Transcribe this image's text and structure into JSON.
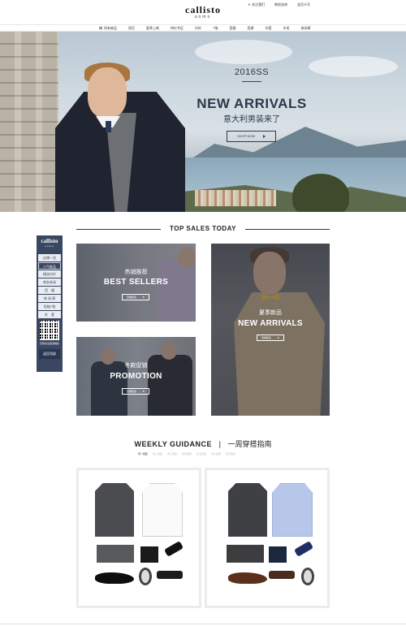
{
  "brand": {
    "name": "callisto",
    "sub": "uomo"
  },
  "toplinks": {
    "favorite": "关注我们",
    "service": "售前咨询",
    "vip": "会员卡号"
  },
  "nav": {
    "items": [
      "所有商品",
      "首页",
      "夏季上新",
      "特价专区",
      "衬衫",
      "T恤",
      "西服",
      "西裤",
      "外套",
      "羊毛",
      "休闲裤"
    ]
  },
  "hero": {
    "season": "2016SS",
    "title": "NEW ARRIVALS",
    "subtitle": "意大利男装来了",
    "button": "SHOP NOW"
  },
  "top_sales": {
    "title": "TOP SALES TODAY"
  },
  "sidebar": {
    "logo_main": "callisto",
    "logo_sub": "uomo",
    "items": [
      "店铺一览",
      "人气新品",
      "精选衬衫",
      "商务休闲",
      "西　服",
      "休 闲 裤",
      "短袖T恤",
      "外　套"
    ],
    "qr_text": "扫码关注更多精彩",
    "top_button": "返回顶部"
  },
  "tiles": {
    "best_sellers": {
      "cn": "热销推荐",
      "en": "BEST SELLERS",
      "btn": "查看更多"
    },
    "new_arrivals": {
      "cn": "夏季新品",
      "en": "NEW ARRIVALS",
      "btn": "查看更多"
    },
    "promotion": {
      "cn": "冬款促销",
      "en": "PROMOTION",
      "btn": "查看更多"
    }
  },
  "weekly": {
    "title_en": "WEEKLY GUIDANCE",
    "separator": "|",
    "title_cn": "一周穿搭指南",
    "tabs": [
      "周一搭配",
      "周二搭配",
      "周三搭配",
      "周四搭配",
      "周五搭配",
      "周六搭配",
      "周日搭配"
    ]
  },
  "colors": {
    "accent": "#3a4762",
    "hero_text": "#2a3a4a"
  }
}
